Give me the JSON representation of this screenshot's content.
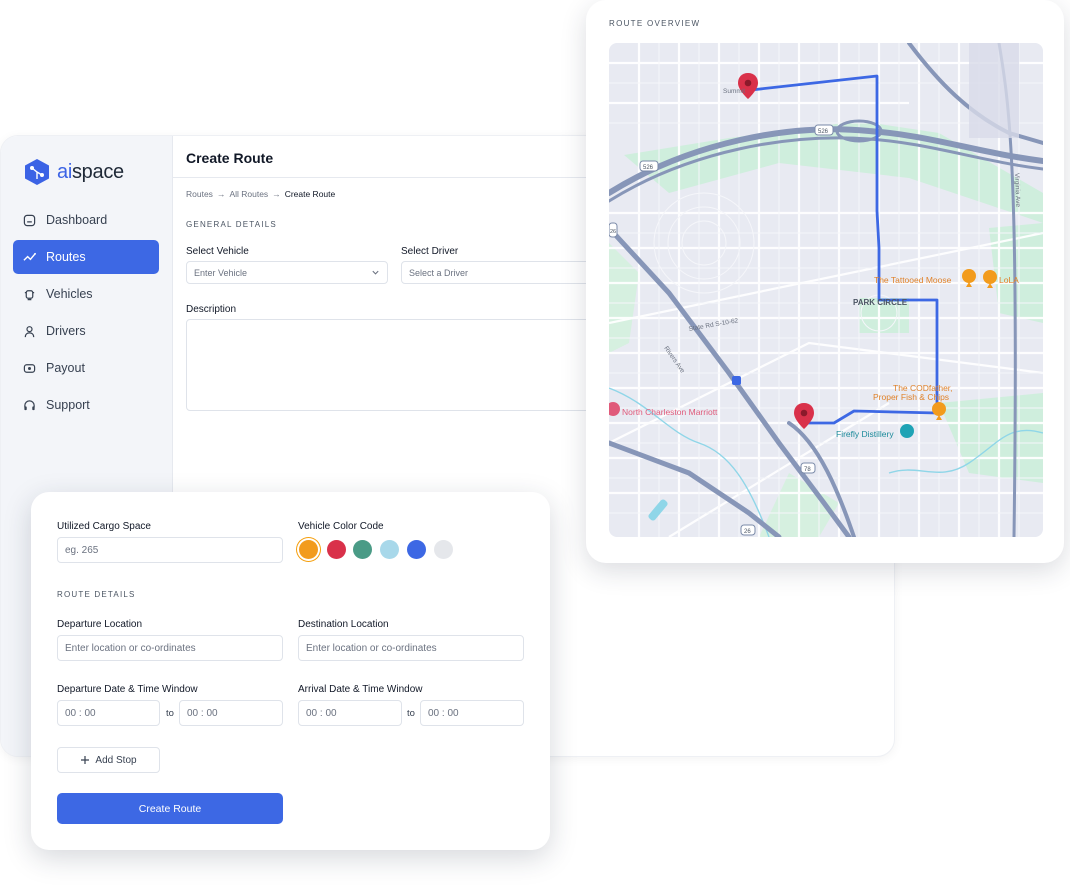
{
  "brand": {
    "name_prefix": "ai",
    "name_suffix": "space"
  },
  "sidebar": {
    "items": [
      {
        "label": "Dashboard",
        "icon": "dashboard-icon"
      },
      {
        "label": "Routes",
        "icon": "routes-icon",
        "active": true
      },
      {
        "label": "Vehicles",
        "icon": "vehicle-icon"
      },
      {
        "label": "Drivers",
        "icon": "user-icon"
      },
      {
        "label": "Payout",
        "icon": "payout-icon"
      },
      {
        "label": "Support",
        "icon": "headset-icon"
      }
    ]
  },
  "header": {
    "title": "Create Route"
  },
  "breadcrumb": {
    "item1": "Routes",
    "sep": "→",
    "item2": "All Routes",
    "current": "Create Route"
  },
  "general": {
    "section": "GENERAL DETAILS",
    "vehicle_label": "Select Vehicle",
    "vehicle_placeholder": "Enter Vehicle",
    "driver_label": "Select Driver",
    "driver_placeholder": "Select a Driver",
    "description_label": "Description"
  },
  "map": {
    "title": "ROUTE OVERVIEW",
    "labels": {
      "park_circle": "PARK CIRCLE",
      "tattooed_moose": "The Tattooed Moose",
      "lola": "LoLA",
      "codfather_1": "The CODfather,",
      "codfather_2": "Proper Fish & Chips",
      "marriott": "North Charleston Marriott",
      "firefly": "Firefly Distillery",
      "state_rd": "State Rd S-10-62",
      "virginia_ave": "Virginia Ave",
      "summit": "Summit",
      "rivers_ave": "Rivers Ave",
      "shield_526a": "526",
      "shield_526b": "526",
      "shield_78": "78",
      "shield_26": "26",
      "shield_i26": "26"
    }
  },
  "form": {
    "cargo_label": "Utilized Cargo Space",
    "cargo_placeholder": "eg. 265",
    "color_label": "Vehicle Color Code",
    "colors": [
      "#f29b1d",
      "#d9314a",
      "#4a9b86",
      "#a8d8ea",
      "#3d68e4",
      "#e5e7eb"
    ],
    "route_section": "ROUTE DETAILS",
    "departure_label": "Departure Location",
    "departure_placeholder": "Enter location or co-ordinates",
    "destination_label": "Destination Location",
    "destination_placeholder": "Enter location or co-ordinates",
    "dep_window_label": "Departure Date & Time Window",
    "arr_window_label": "Arrival Date & Time Window",
    "time_placeholder": "00 : 00",
    "to": "to",
    "add_stop": "Add Stop",
    "submit": "Create Route"
  }
}
